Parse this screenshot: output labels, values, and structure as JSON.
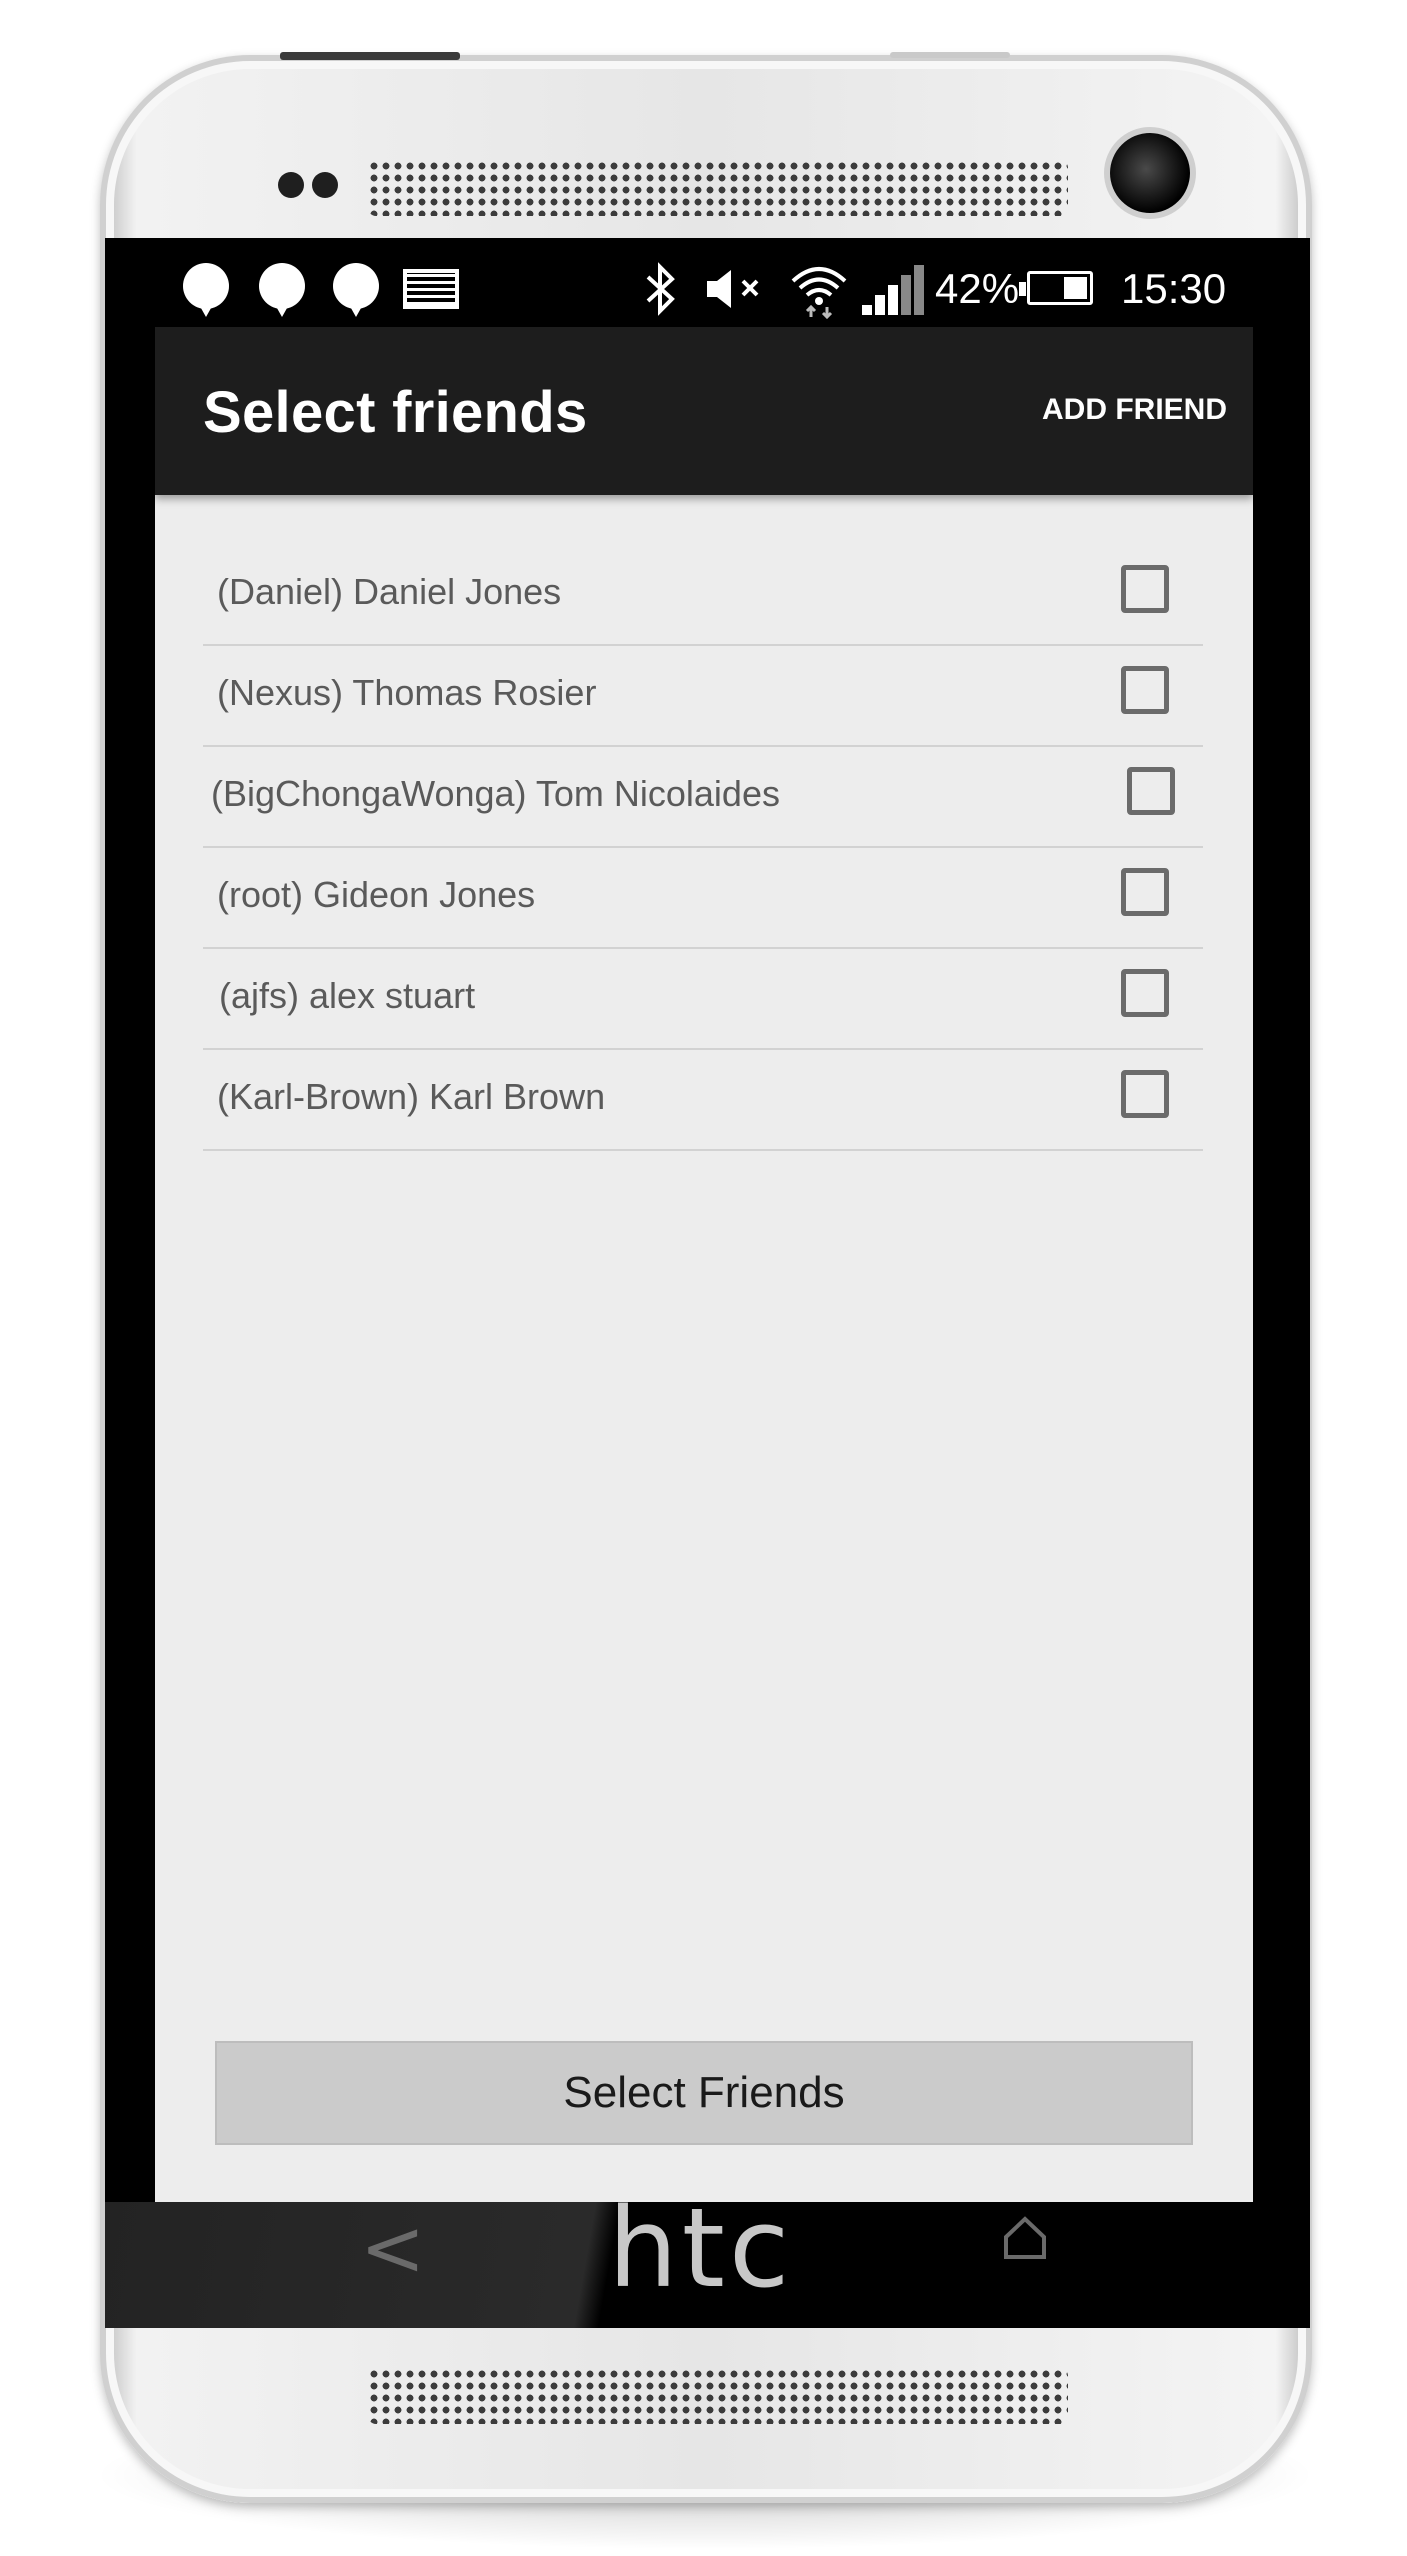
{
  "device": {
    "brand_logo": "htc",
    "accent_colors": {
      "app_bar": "#1d1d1d",
      "screen_bg": "#ededed",
      "button_bg": "#cbcbcb"
    }
  },
  "status_bar": {
    "notification_icons": [
      "chat-bubble-icon",
      "chat-bubble-icon",
      "chat-bubble-icon",
      "image-icon"
    ],
    "system_icons": [
      "bluetooth-icon",
      "mute-icon",
      "wifi-icon",
      "signal-icon"
    ],
    "battery": "42%",
    "battery_level": 0.42,
    "time": "15:30"
  },
  "app_bar": {
    "title": "Select friends",
    "action_label": "ADD FRIEND"
  },
  "friends": [
    {
      "label": "(Daniel) Daniel Jones",
      "checked": false
    },
    {
      "label": "(Nexus) Thomas Rosier",
      "checked": false
    },
    {
      "label": "(BigChongaWonga) Tom Nicolaides",
      "checked": false
    },
    {
      "label": "(root) Gideon Jones",
      "checked": false
    },
    {
      "label": "(ajfs) alex stuart",
      "checked": false
    },
    {
      "label": "(Karl-Brown) Karl Brown",
      "checked": false
    }
  ],
  "footer": {
    "button_label": "Select Friends"
  },
  "nav": {
    "back_glyph": "<",
    "home_icon": "home-icon"
  }
}
